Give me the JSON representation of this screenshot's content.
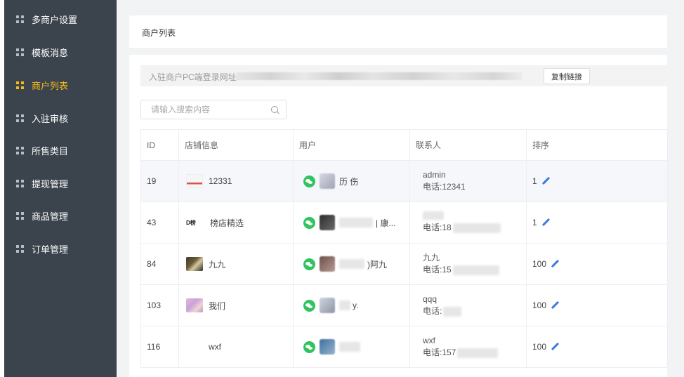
{
  "sidebar": {
    "items": [
      {
        "label": "多商户设置",
        "active": false
      },
      {
        "label": "模板消息",
        "active": false
      },
      {
        "label": "商户列表",
        "active": true
      },
      {
        "label": "入驻审核",
        "active": false
      },
      {
        "label": "所售类目",
        "active": false
      },
      {
        "label": "提现管理",
        "active": false
      },
      {
        "label": "商品管理",
        "active": false
      },
      {
        "label": "订单管理",
        "active": false
      }
    ],
    "active_color": "#f5b91a"
  },
  "header": {
    "title": "商户列表"
  },
  "url_bar": {
    "label": "入驻商户PC端登录网址:",
    "copy_button": "复制链接"
  },
  "search": {
    "placeholder": "请输入搜索内容"
  },
  "table": {
    "columns": [
      "ID",
      "店铺信息",
      "用户",
      "联系人",
      "排序"
    ],
    "rows": [
      {
        "id": "19",
        "shop": "12331",
        "user": "历 伤",
        "contact": "admin",
        "phone": "电话:12341",
        "sort": "1"
      },
      {
        "id": "43",
        "shop": "榜店精选",
        "shop_logo": "D榜",
        "user": "| 康...",
        "contact": "",
        "phone": "电话:18",
        "sort": "1"
      },
      {
        "id": "84",
        "shop": "九九",
        "user": ")阿九",
        "contact": "九九",
        "phone": "电话:15",
        "sort": "100"
      },
      {
        "id": "103",
        "shop": "我们",
        "user": "y.",
        "contact": "qqq",
        "phone": "电话:",
        "sort": "100"
      },
      {
        "id": "116",
        "shop": "wxf",
        "user": "",
        "contact": "wxf",
        "phone": "电话:157",
        "sort": "100"
      }
    ]
  }
}
